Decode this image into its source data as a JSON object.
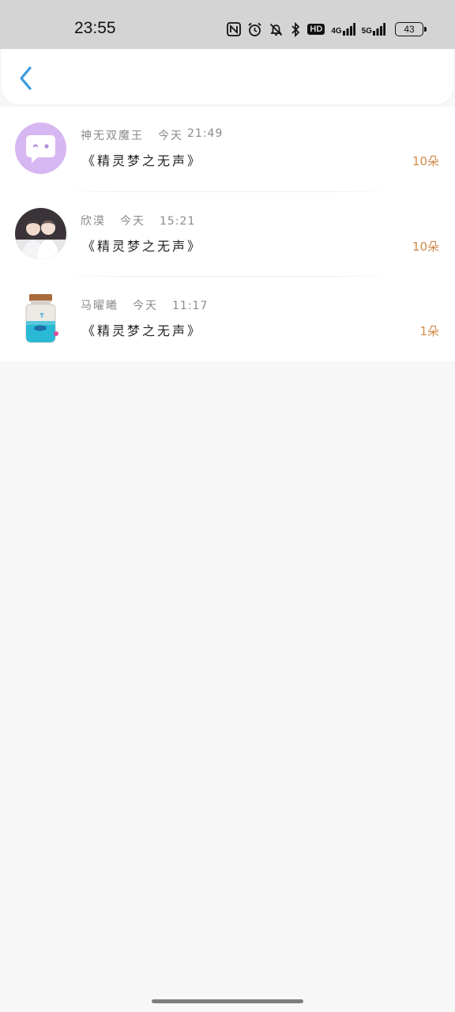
{
  "status_bar": {
    "time": "23:55",
    "network_4g": "4G",
    "network_5g": "5G",
    "hd_label": "HD",
    "battery": "43"
  },
  "header": {
    "back_icon": "chevron-left-icon",
    "accent_color": "#3b9be0"
  },
  "list": {
    "items": [
      {
        "name": "神无双魔王",
        "day": "今天",
        "time": "21:49",
        "title": "《精灵梦之无声》",
        "count": "10朵",
        "avatar": "chat-bubble-face"
      },
      {
        "name": "欣漠",
        "day": "今天",
        "time": "15:21",
        "title": "《精灵梦之无声》",
        "count": "10朵",
        "avatar": "photo-two-people"
      },
      {
        "name": "马曜曦",
        "day": "今天",
        "time": "11:17",
        "title": "《精灵梦之无声》",
        "count": "1朵",
        "avatar": "bottle-whale"
      }
    ],
    "count_color": "#cf8a4a"
  }
}
